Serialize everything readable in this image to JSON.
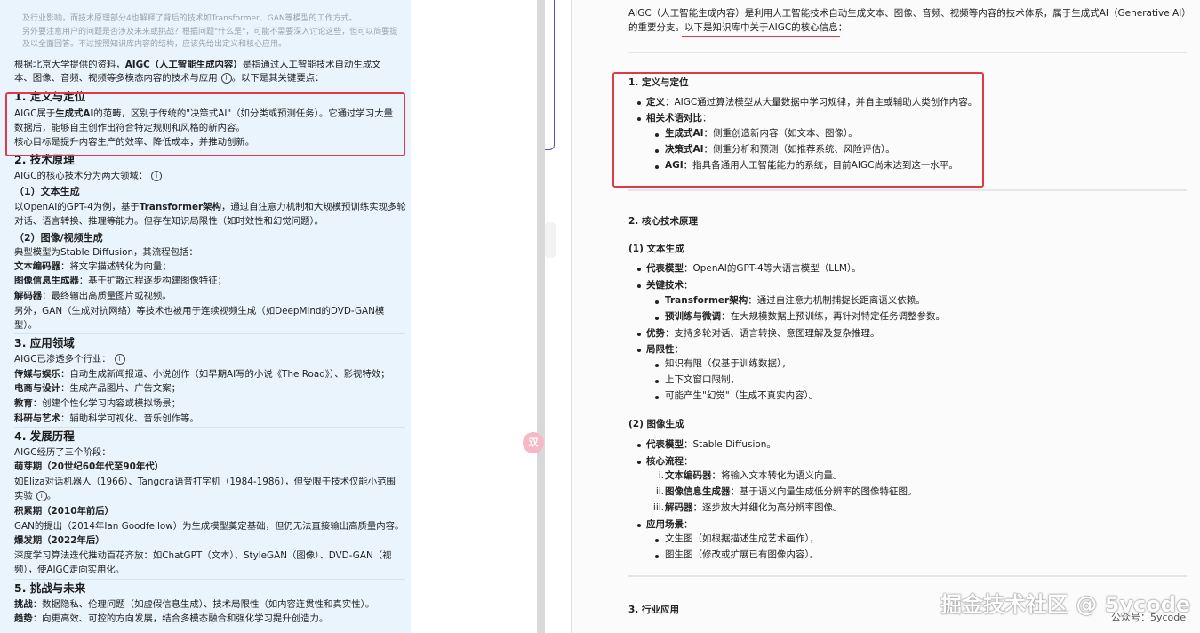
{
  "left": {
    "faint_lines": [
      "及行业影响，而技术原理部分4也解释了背后的技术如Transformer、GAN等模型的工作方式。",
      "另外要注意用户的问题是否涉及未来或挑战？根据问题\"什么是\"，可能不需要深入讨论这些，但可以简要提",
      "及以全面回答。不过按照知识库内容的结构，应该先给出定义和核心应用。"
    ],
    "intro_a": "根据北京大学提供的资料，",
    "intro_b": "AIGC（人工智能生成内容）",
    "intro_c": "是指通过人工智能技术自动生成文",
    "intro_line2": "本、图像、音频、视频等多模态内容的技术与应用",
    "intro_tail": "。以下是其关键要点：",
    "s1_title": "1. 定义与定位",
    "s1_l1a": "AIGC属于",
    "s1_l1b": "生成式AI",
    "s1_l1c": "的范畴，区别于传统的\"决策式AI\"（如分类或预测任务）。它通过学习大量",
    "s1_l2": "数据后，能够自主创作出符合特定规则和风格的新内容。",
    "s1_l3": "核心目标是提升内容生产的效率、降低成本，并推动创新。",
    "s2_title": "2. 技术原理",
    "s2_l1": "AIGC的核心技术分为两大领域：",
    "s2_sub1": "（1）文本生成",
    "s2_t1a": "以OpenAI的GPT-4为例，基于",
    "s2_t1b": "Transformer架构",
    "s2_t1c": "，通过自注意力机制和大规模预训练实现多轮",
    "s2_t2": "对话、语言转换、推理等能力。但存在知识局限性（如时效性和幻觉问题）。",
    "s2_sub2": "（2）图像/视频生成",
    "s2_i1": "典型模型为Stable Diffusion，其流程包括：",
    "s2_i2a": "文本编码器",
    "s2_i2b": "：将文字描述转化为向量；",
    "s2_i3a": "图像信息生成器",
    "s2_i3b": "：基于扩散过程逐步构建图像特征；",
    "s2_i4a": "解码器",
    "s2_i4b": "：最终输出高质量图片或视频。",
    "s2_i5": "另外，GAN（生成对抗网络）等技术也被用于连续视频生成（如DeepMind的DVD-GAN模",
    "s2_i6": "型）。",
    "s3_title": "3. 应用领域",
    "s3_l1": "AIGC已渗透多个行业：",
    "s3_a_a": "传媒与娱乐",
    "s3_a_b": "：自动生成新闻报道、小说创作（如早期AI写的小说《The Road》）、影视特效；",
    "s3_b_a": "电商与设计",
    "s3_b_b": "：生成产品图片、广告文案；",
    "s3_c_a": "教育",
    "s3_c_b": "：创建个性化学习内容或模拟场景；",
    "s3_d_a": "科研与艺术",
    "s3_d_b": "：辅助科学可视化、音乐创作等。",
    "s4_title": "4. 发展历程",
    "s4_l1": "AIGC经历了三个阶段：",
    "s4_p1": "萌芽期（20世纪60年代至90年代）",
    "s4_p1a": "如Eliza对话机器人（1966）、Tangora语音打字机（1984-1986），但受限于技术仅能小范围",
    "s4_p1b": "实验",
    "s4_p1c": "。",
    "s4_p2": "积累期（2010年前后）",
    "s4_p2a": "GAN的提出（2014年Ian Goodfellow）为生成模型奠定基础，但仍无法直接输出高质量内容。",
    "s4_p3": "爆发期（2022年后）",
    "s4_p3a": "深度学习算法迭代推动百花齐放：如ChatGPT（文本）、StyleGAN（图像）、DVD-GAN（视",
    "s4_p3b": "频），使AIGC走向实用化。",
    "s5_title": "5. 挑战与未来",
    "s5_l1a": "挑战",
    "s5_l1b": "：数据隐私、伦理问题（如虚假信息生成）、技术局限性（如内容连贯性和真实性）。",
    "s5_l2a": "趋势",
    "s5_l2b": "：向更高效、可控的方向发展，结合多模态融合和强化学习提升创造力。"
  },
  "right": {
    "intro_1": "AIGC（人工智能生成内容）是利用人工智能技术自动生成文本、图像、音频、视频等内容的技术体系，属于生成式AI（Generative AI）",
    "intro_2a": "的重要分支。",
    "intro_2b": "以下是知识库中关于AIGC的核心信息：",
    "s1_title": "1. 定义与定位",
    "s1_b1a": "定义",
    "s1_b1b": "：AIGC通过算法模型从大量数据中学习规律，并自主或辅助人类创作内容。",
    "s1_b2a": "相关术语对比",
    "s1_b2b": "：",
    "s1_c1a": "生成式AI",
    "s1_c1b": "：侧重创造新内容（如文本、图像）。",
    "s1_c2a": "决策式AI",
    "s1_c2b": "：侧重分析和预测（如推荐系统、风险评估）。",
    "s1_c3a": "AGI",
    "s1_c3b": "：指具备通用人工智能能力的系统，目前AIGC尚未达到这一水平。",
    "s2_title": "2. 核心技术原理",
    "s2_sub1": "(1) 文本生成",
    "s2_b1a": "代表模型",
    "s2_b1b": "：OpenAI的GPT-4等大语言模型（LLM）。",
    "s2_b2a": "关键技术",
    "s2_b2b": "：",
    "s2_c1a": "Transformer架构",
    "s2_c1b": "：通过自注意力机制捕捉长距离语义依赖。",
    "s2_c2a": "预训练与微调",
    "s2_c2b": "：在大规模数据上预训练，再针对特定任务调整参数。",
    "s2_b3a": "优势",
    "s2_b3b": "：支持多轮对话、语言转换、意图理解及复杂推理。",
    "s2_b4a": "局限性",
    "s2_b4b": "：",
    "s2_d1": "知识有限（仅基于训练数据），",
    "s2_d2": "上下文窗口限制，",
    "s2_d3": "可能产生\"幻觉\"（生成不真实内容）。",
    "s2_sub2": "(2) 图像生成",
    "s2_e1a": "代表模型",
    "s2_e1b": "：Stable Diffusion。",
    "s2_e2a": "核心流程",
    "s2_e2b": "：",
    "s2_n1": "i.",
    "s2_n1a": "文本编码器",
    "s2_n1b": "：将输入文本转化为语义向量。",
    "s2_n2": "ii.",
    "s2_n2a": "图像信息生成器",
    "s2_n2b": "：基于语义向量生成低分辨率的图像特征图。",
    "s2_n3": "iii.",
    "s2_n3a": "解码器",
    "s2_n3b": "：逐步放大并细化为高分辨率图像。",
    "s2_e3a": "应用场景",
    "s2_e3b": "：",
    "s2_f1": "文生图（如根据描述生成艺术画作），",
    "s2_f2": "图生图（修改或扩展已有图像内容）。",
    "s3_title": "3. 行业应用"
  },
  "translate_label": "双",
  "watermark": "掘金技术社区 @ 5ycode",
  "wechat": "公众号：5ycode",
  "colors": {
    "highlight_border": "#e0394a",
    "left_bg": "#eaf4fd",
    "accent": "#5b4bd6"
  }
}
